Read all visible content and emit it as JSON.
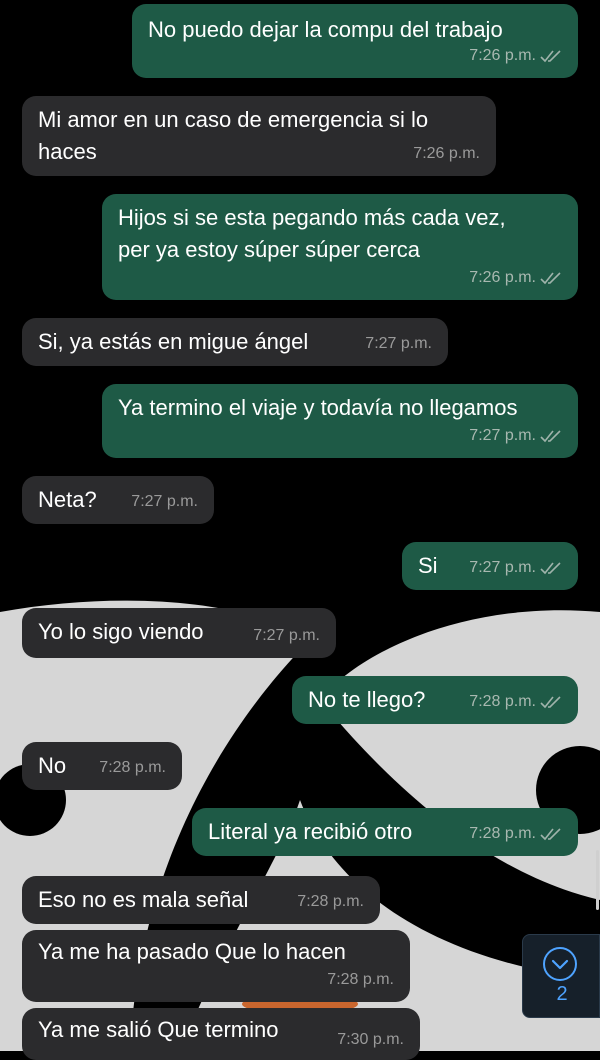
{
  "colors": {
    "outgoing_bubble": "#1e5a46",
    "incoming_bubble": "#2b2b2d",
    "read_ticks": "#9fb3ab",
    "accent": "#4ea3ff"
  },
  "messages": [
    {
      "dir": "out",
      "lines": "No puedo dejar la compu del trabajo",
      "time": "7:26 p.m.",
      "read": true
    },
    {
      "dir": "in",
      "lines": "Mi amor en un caso de emergencia si lo\nhaces",
      "time": "7:26 p.m."
    },
    {
      "dir": "out",
      "lines": "Hijos si se esta pegando más cada vez,\nper ya estoy súper súper cerca",
      "time": "7:26 p.m.",
      "read": true
    },
    {
      "dir": "in",
      "lines": "Si, ya estás en migue ángel",
      "time": "7:27 p.m."
    },
    {
      "dir": "out",
      "lines": "Ya termino el viaje y todavía no llegamos",
      "time": "7:27 p.m.",
      "read": true
    },
    {
      "dir": "in",
      "lines": "Neta?",
      "time": "7:27 p.m."
    },
    {
      "dir": "out",
      "lines": "Si",
      "time": "7:27 p.m.",
      "read": true
    },
    {
      "dir": "in",
      "lines": "Yo lo sigo viendo",
      "time": "7:27 p.m."
    },
    {
      "dir": "out",
      "lines": "No te llego?",
      "time": "7:28 p.m.",
      "read": true
    },
    {
      "dir": "in",
      "lines": "No",
      "time": "7:28 p.m."
    },
    {
      "dir": "out",
      "lines": "Literal ya recibió otro",
      "time": "7:28 p.m.",
      "read": true
    },
    {
      "dir": "in",
      "lines": "Eso no es mala señal",
      "time": "7:28 p.m."
    },
    {
      "dir": "in",
      "lines": "Ya me ha pasado Que lo hacen",
      "time": "7:28 p.m."
    },
    {
      "dir": "in",
      "lines": "Ya me salió Que termino",
      "time": "7:30 p.m."
    }
  ],
  "scroll_to_bottom": {
    "icon": "chevron-down-icon",
    "unread_count": "2"
  }
}
